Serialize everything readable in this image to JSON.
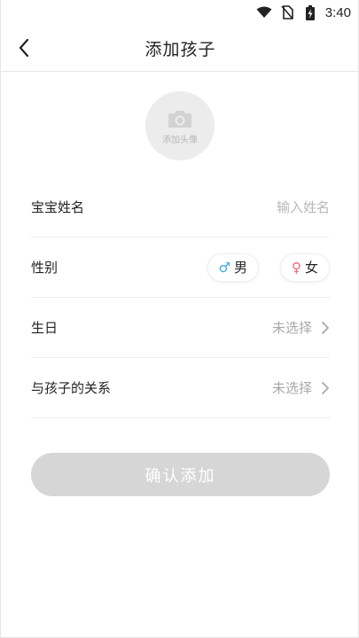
{
  "status_bar": {
    "time": "3:40",
    "icons": [
      "wifi-icon",
      "no-sim-icon",
      "battery-charging-icon"
    ]
  },
  "header": {
    "back_icon": "chevron-left-icon",
    "title": "添加孩子"
  },
  "avatar": {
    "icon": "camera-icon",
    "label": "添加头像"
  },
  "form": {
    "name": {
      "label": "宝宝姓名",
      "placeholder": "输入姓名",
      "value": ""
    },
    "gender": {
      "label": "性别",
      "options": [
        {
          "symbol": "♂",
          "label": "男",
          "color": "#3aa7e6"
        },
        {
          "symbol": "♀",
          "label": "女",
          "color": "#f2607a"
        }
      ]
    },
    "birthday": {
      "label": "生日",
      "value": "未选择"
    },
    "relation": {
      "label": "与孩子的关系",
      "value": "未选择"
    }
  },
  "confirm_button": {
    "label": "确认添加",
    "color": "#d6d6d6"
  }
}
